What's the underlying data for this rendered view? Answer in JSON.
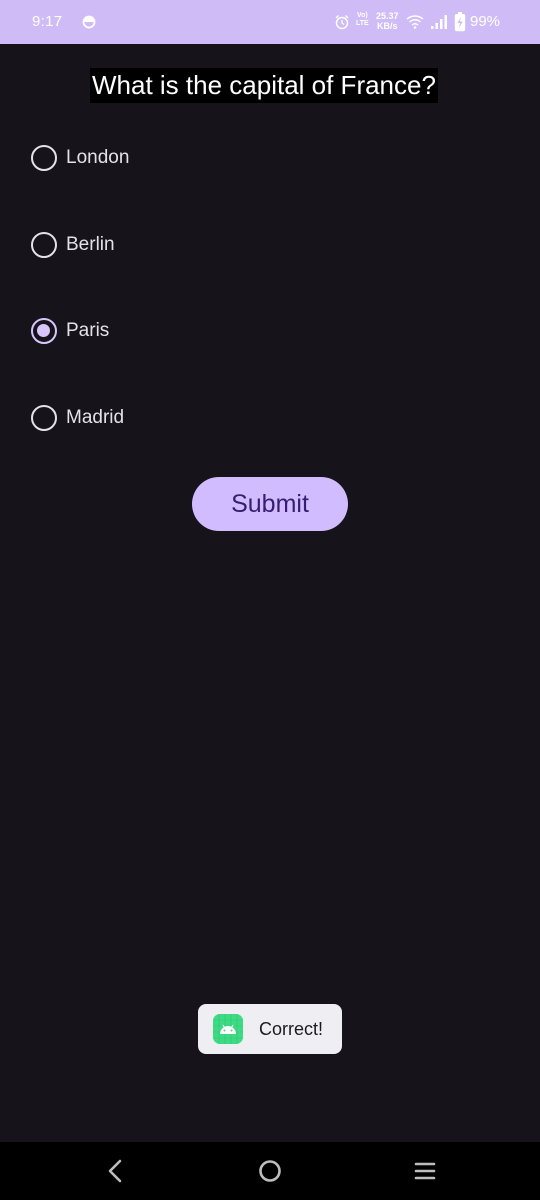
{
  "status_bar": {
    "time": "9:17",
    "volte_top": "Vo)",
    "volte_bottom": "LTE",
    "speed_value": "25.37",
    "speed_unit": "KB/s",
    "battery": "99%",
    "color": "#cfbcf6"
  },
  "question": "What is the capital of France?",
  "options": [
    {
      "label": "London",
      "selected": false
    },
    {
      "label": "Berlin",
      "selected": false
    },
    {
      "label": "Paris",
      "selected": true
    },
    {
      "label": "Madrid",
      "selected": false
    }
  ],
  "submit_label": "Submit",
  "toast": {
    "text": "Correct!",
    "icon": "android-app-icon"
  },
  "nav_bar": {
    "back_icon": "back-chevron-icon",
    "home_icon": "home-circle-icon",
    "recents_icon": "recents-lines-icon"
  },
  "colors": {
    "background": "#16131a",
    "accent": "#d0bcff",
    "on_accent": "#381e72"
  }
}
